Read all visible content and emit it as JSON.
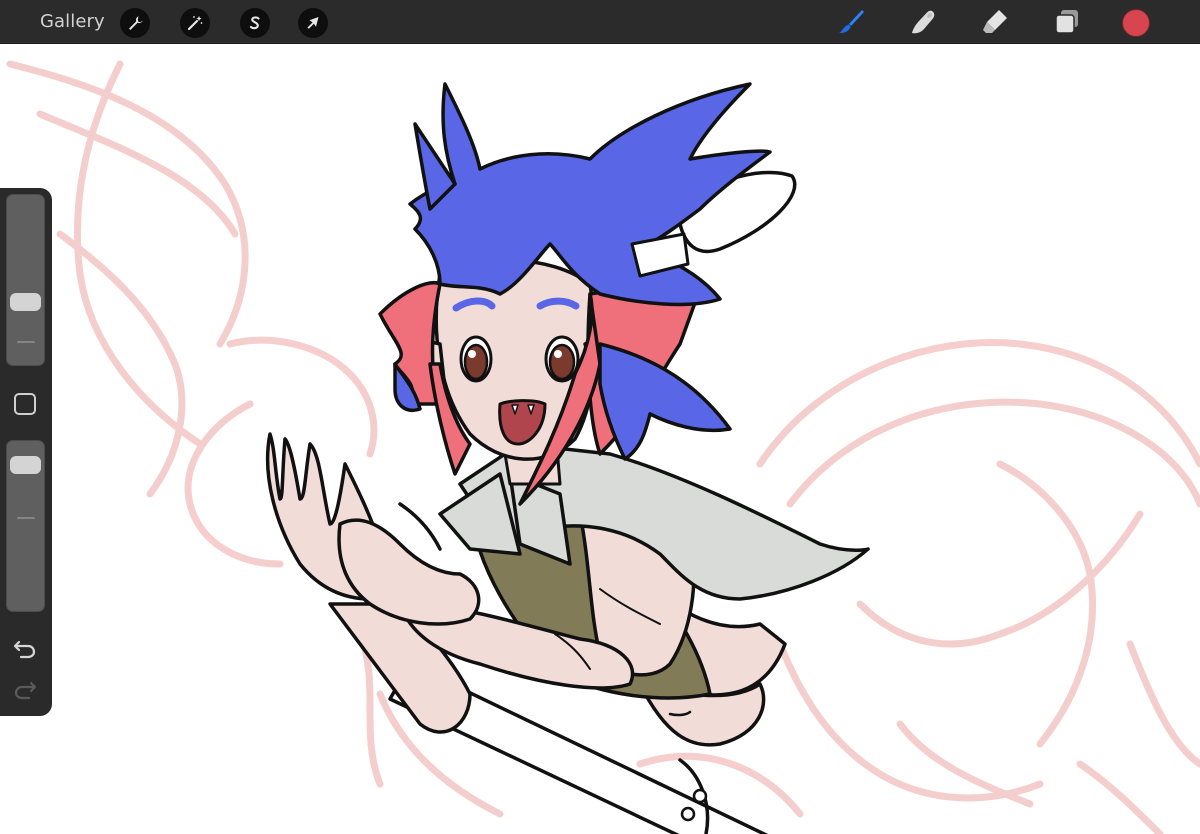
{
  "toolbar": {
    "gallery_label": "Gallery",
    "left_tools": [
      {
        "name": "actions",
        "icon": "wrench-icon"
      },
      {
        "name": "adjustments",
        "icon": "magic-wand-icon"
      },
      {
        "name": "selection",
        "icon": "selection-s-icon"
      },
      {
        "name": "transform",
        "icon": "arrow-cursor-icon"
      }
    ],
    "right_tools": [
      {
        "name": "brush",
        "icon": "brush-icon",
        "active": true,
        "color": "#1f6fe0"
      },
      {
        "name": "smudge",
        "icon": "smudge-finger-icon",
        "active": false
      },
      {
        "name": "eraser",
        "icon": "eraser-icon",
        "active": false
      },
      {
        "name": "layers",
        "icon": "layers-icon",
        "active": false
      }
    ],
    "current_color": "#d64550"
  },
  "sidebar": {
    "brush_size_level": 0.35,
    "opacity_level": 0.92,
    "modify_button": "modify-square-icon",
    "undo": "undo-arrow-icon",
    "redo": "redo-arrow-icon",
    "redo_enabled": false
  },
  "canvas": {
    "background": "#ffffff",
    "sketch_color": "#f3c6c4",
    "hair_blue": "#5967e6",
    "hair_pink": "#ef6f7b",
    "skin": "#f1dcd8",
    "vest": "#827b58",
    "collar": "#d8dbd7"
  }
}
